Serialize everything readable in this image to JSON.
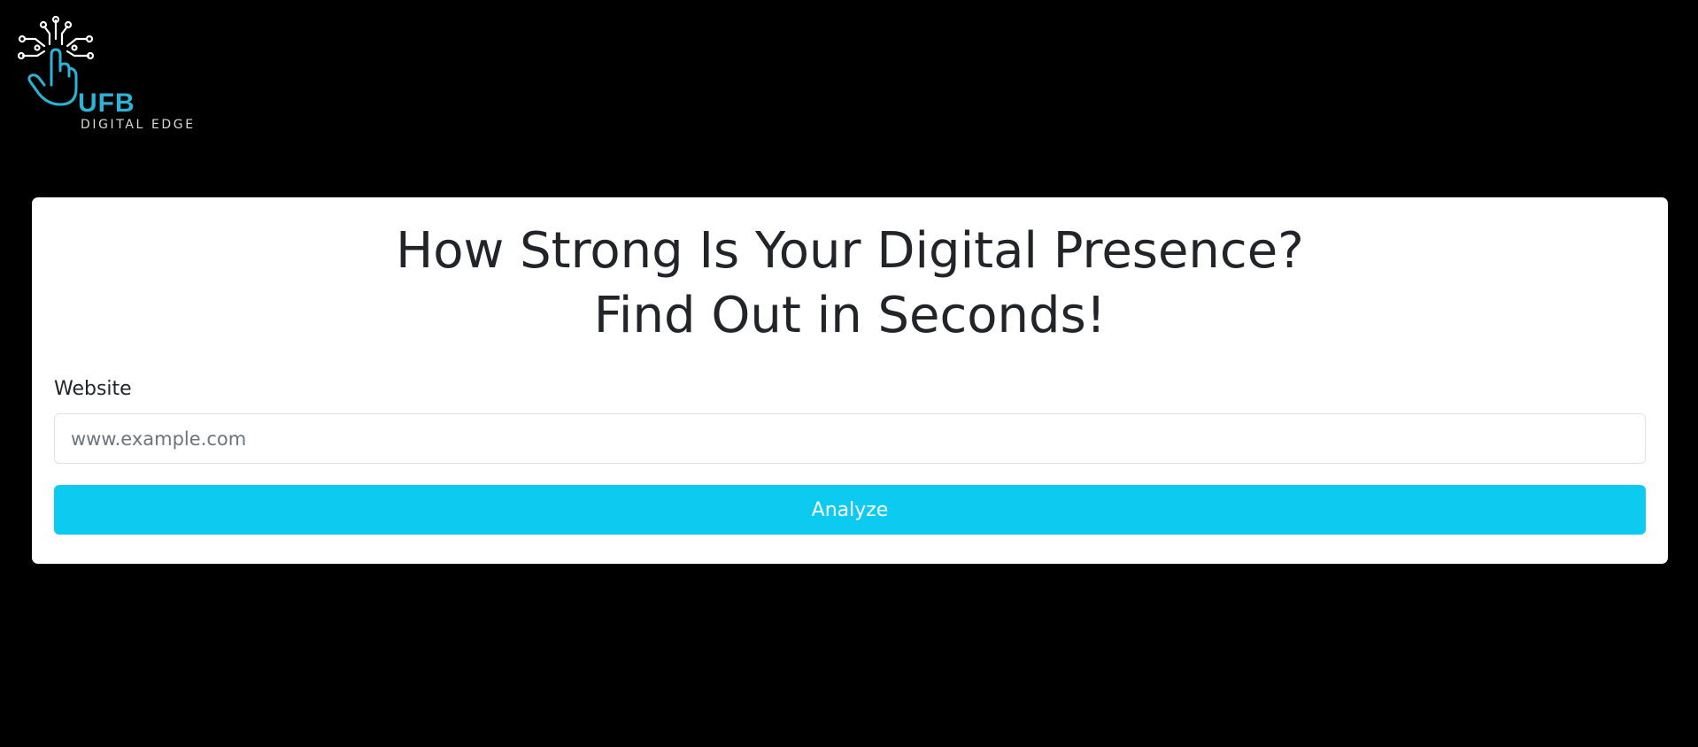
{
  "brand": {
    "logo_icon": "circuit-hand-icon",
    "name": "UFB",
    "tagline": "DIGITAL EDGE",
    "accent_color": "#2bb4d6"
  },
  "hero": {
    "headline_line1": "How Strong Is Your Digital Presence?",
    "headline_line2": "Find Out in Seconds!"
  },
  "form": {
    "website_label": "Website",
    "website_value": "",
    "website_placeholder": "www.example.com",
    "submit_label": "Analyze",
    "submit_color": "#0dcaf0"
  }
}
